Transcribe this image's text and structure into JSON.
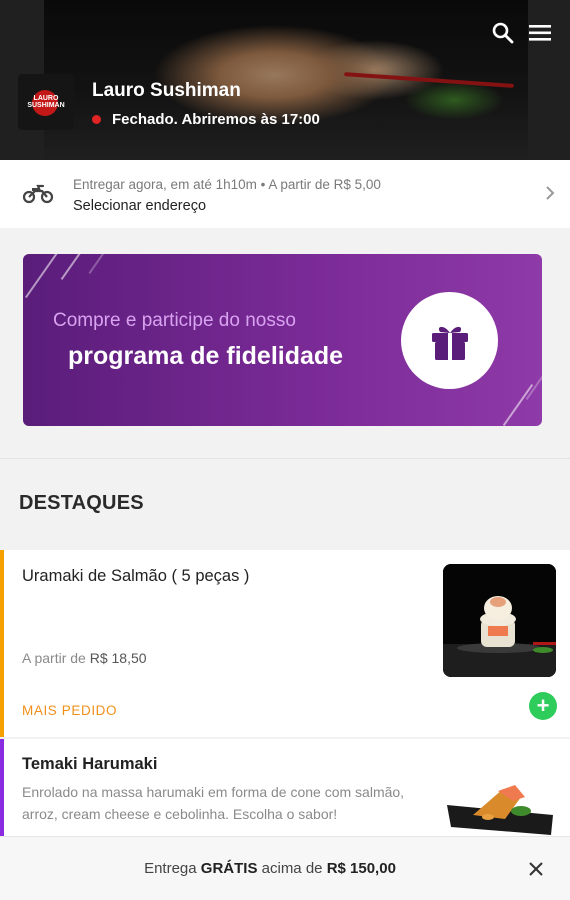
{
  "header": {
    "store_name": "Lauro Sushiman",
    "status": "Fechado. Abriremos às 17:00",
    "logo_text_1": "LAURO",
    "logo_text_2": "SUSHIMAN",
    "icons": {
      "search": "search-icon",
      "menu": "hamburger-menu-icon"
    },
    "status_color": "#e02424"
  },
  "delivery": {
    "info": "Entregar agora, em até 1h10m  •  A partir de R$ 5,00",
    "address_label": "Selecionar endereço",
    "icon": "motorcycle-icon"
  },
  "banner": {
    "line1": "Compre e participe do nosso",
    "line2": "programa de fidelidade",
    "icon": "gift-icon",
    "color": "#7a2a96"
  },
  "section": {
    "title": "DESTAQUES"
  },
  "products": [
    {
      "name": "Uramaki de Salmão ( 5 peças )",
      "price_prefix": "A partir de",
      "price": "R$ 18,50",
      "tag": "MAIS PEDIDO",
      "add_label": "+",
      "accent": "#f5a000"
    },
    {
      "name": "Temaki Harumaki",
      "description": "Enrolado na massa harumaki em forma de cone com salmão, arroz, cream cheese e cebolinha. Escolha o sabor!",
      "accent": "#8a2be2"
    }
  ],
  "bottom_bar": {
    "text_before": "Entrega",
    "text_bold": "GRÁTIS",
    "text_middle": "acima de",
    "amount": "R$ 150,00",
    "close_icon": "close-icon"
  }
}
